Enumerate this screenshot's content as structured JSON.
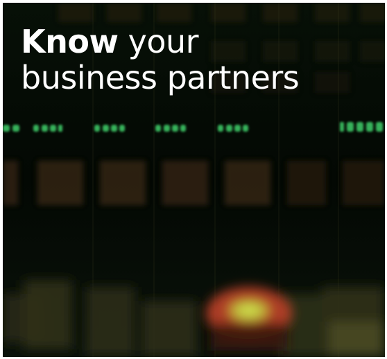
{
  "banner": {
    "headline_bold": "Know",
    "headline_rest": " your",
    "headline_line2": "business partners"
  },
  "colors": {
    "background": "#040a04",
    "text": "#ffffff",
    "led_green": "#3fd06a",
    "glow_amber": "#e0502a",
    "glow_yellow": "#d8ec52"
  },
  "icons": [
    "server-panel-background"
  ]
}
